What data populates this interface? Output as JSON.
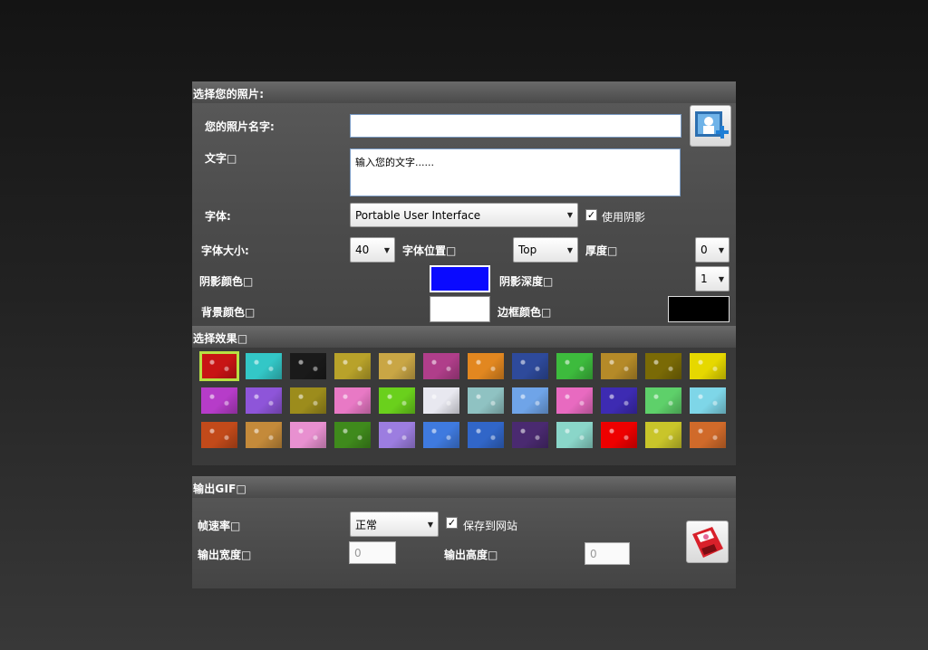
{
  "section_photo": {
    "title": "选择您的照片:",
    "photo_name_label": "您的照片名字:",
    "photo_name_value": "",
    "text_label": "文字",
    "text_value": "输入您的文字......",
    "font_label": "字体:",
    "font_value": "Portable User Interface",
    "shadow_checkbox_label": "使用阴影",
    "shadow_checked": true,
    "font_size_label": "字体大小:",
    "font_size_value": "40",
    "font_position_label": "字体位置",
    "font_position_value": "Top",
    "thickness_label": "厚度",
    "thickness_value": "0",
    "shadow_color_label": "阴影颜色",
    "shadow_color": "#0000ff",
    "shadow_depth_label": "阴影深度",
    "shadow_depth_value": "1",
    "bg_color_label": "背景颜色",
    "bg_color": "#ffffff",
    "border_color_label": "边框颜色",
    "border_color": "#000000",
    "add_photo_icon": "add-photo-icon"
  },
  "section_effects": {
    "title": "选择效果",
    "selected_index": 0,
    "tiles": [
      "#c81414",
      "#33c7c7",
      "#1a1a1a",
      "#b8a22a",
      "#c9a645",
      "#b03e8a",
      "#e28720",
      "#2e4a9b",
      "#3dbb3d",
      "#b58a28",
      "#7a6a06",
      "#e6d800",
      "#b63cc9",
      "#8e55d9",
      "#9c8c1c",
      "#e879c5",
      "#6ad01c",
      "#e8e8f0",
      "#8fc2c2",
      "#6fa4e8",
      "#e86ac0",
      "#3d2bb2",
      "#5ed06a",
      "#7ed6e8",
      "#c24a1a",
      "#c48a3a",
      "#e890d0",
      "#3f8a1c",
      "#9c7de0",
      "#3f7adf",
      "#3166c8",
      "#4a2a70",
      "#8ad6c9",
      "#ee0000",
      "#c9c52a",
      "#d06a2a"
    ]
  },
  "section_output": {
    "title": "输出GIF",
    "frame_rate_label": "帧速率",
    "frame_rate_value": "正常",
    "save_to_site_label": "保存到网站",
    "save_checked": true,
    "width_label": "输出宽度",
    "width_value": "0",
    "height_label": "输出高度",
    "height_value": "0",
    "save_icon": "save-disk-icon"
  }
}
